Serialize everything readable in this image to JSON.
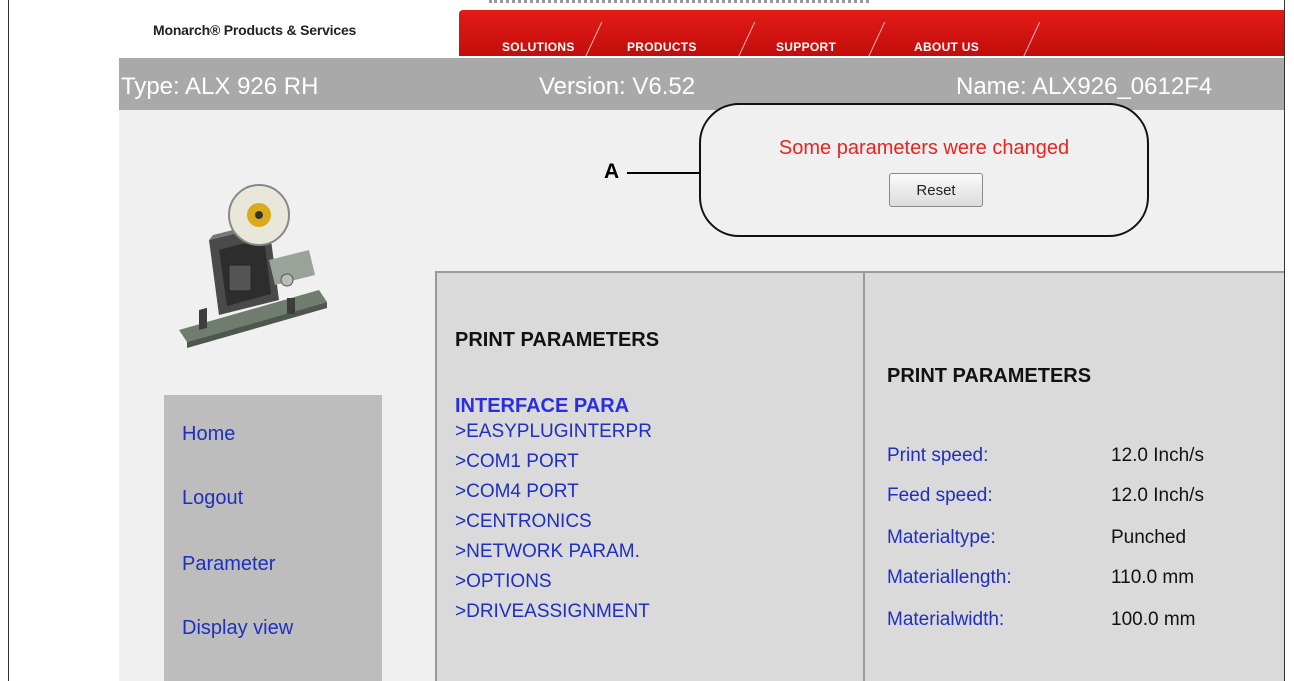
{
  "header": {
    "brand": "Monarch® Products & Services",
    "nav": [
      "SOLUTIONS",
      "PRODUCTS",
      "SUPPORT",
      "ABOUT US"
    ]
  },
  "info_bar": {
    "type": "Type: ALX 926 RH",
    "version": "Version: V6.52",
    "name": "Name: ALX926_0612F4"
  },
  "callout": {
    "label": "A",
    "message": "Some parameters were changed",
    "reset_label": "Reset"
  },
  "sidebar": {
    "items": [
      "Home",
      "Logout",
      "Parameter",
      "Display view"
    ]
  },
  "center_panel": {
    "title": "PRINT PARAMETERS",
    "section": "INTERFACE PARA",
    "links": [
      ">EASYPLUGINTERPR",
      ">COM1 PORT",
      ">COM4 PORT",
      ">CENTRONICS",
      ">NETWORK PARAM.",
      ">OPTIONS",
      ">DRIVEASSIGNMENT"
    ]
  },
  "right_panel": {
    "title": "PRINT PARAMETERS",
    "params": [
      {
        "label": "Print speed:",
        "value": "12.0 Inch/s"
      },
      {
        "label": "Feed speed:",
        "value": "12.0 Inch/s"
      },
      {
        "label": "Materialtype:",
        "value": "Punched"
      },
      {
        "label": "Materiallength:",
        "value": "110.0 mm"
      },
      {
        "label": "Materialwidth:",
        "value": "100.0 mm"
      }
    ]
  },
  "colors": {
    "nav_red": "#e41b17",
    "info_bar_gray": "#a9a9a9",
    "link_blue": "#1f2fbf",
    "alert_red": "#e8241f"
  }
}
